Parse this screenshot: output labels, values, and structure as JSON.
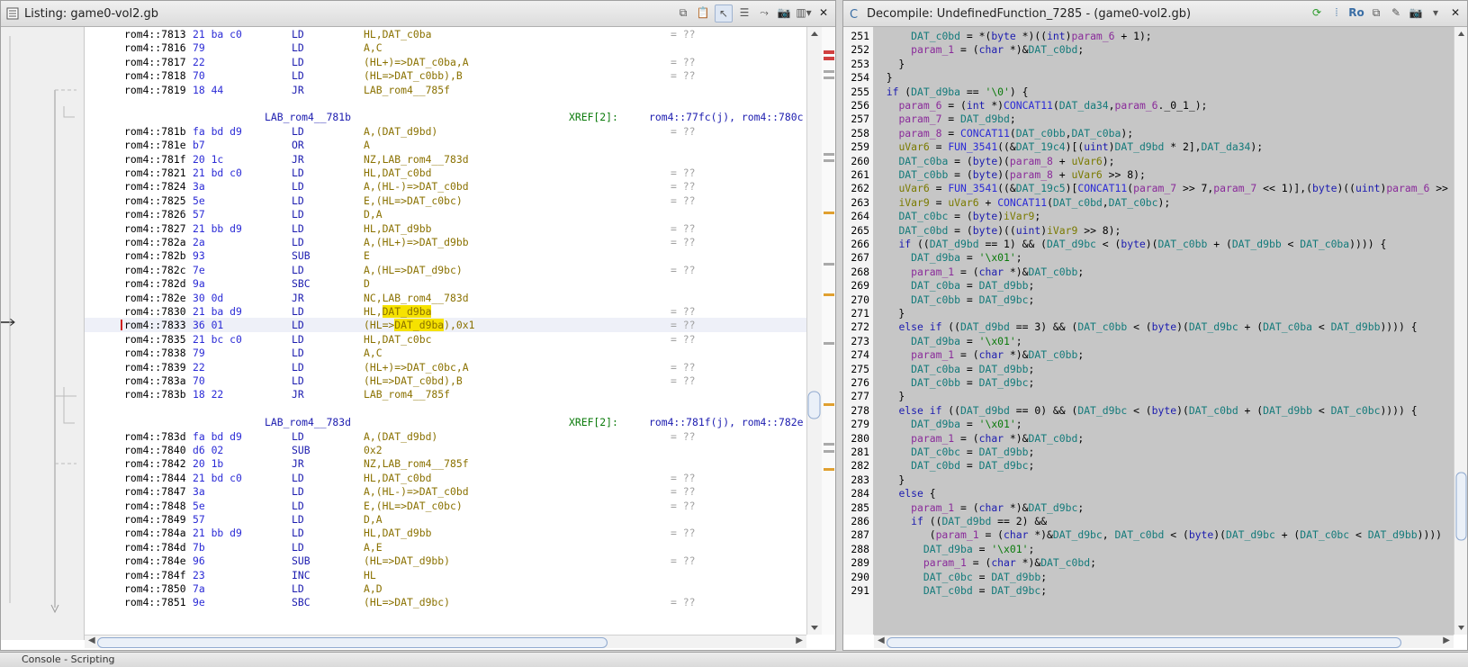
{
  "listing": {
    "title": "Listing:  game0-vol2.gb",
    "rows": [
      {
        "a": "rom4::7813",
        "b": "21 ba c0",
        "m": "LD",
        "o": "HL,DAT_c0ba",
        "c": "= ??"
      },
      {
        "a": "rom4::7816",
        "b": "79",
        "m": "LD",
        "o": "A,C",
        "c": ""
      },
      {
        "a": "rom4::7817",
        "b": "22",
        "m": "LD",
        "o": "(HL+)=>DAT_c0ba,A",
        "c": "= ??"
      },
      {
        "a": "rom4::7818",
        "b": "70",
        "m": "LD",
        "o": "(HL=>DAT_c0bb),B",
        "c": "= ??"
      },
      {
        "a": "rom4::7819",
        "b": "18 44",
        "m": "JR",
        "o": "LAB_rom4__785f",
        "c": ""
      },
      {
        "blank": true
      },
      {
        "label": "LAB_rom4__781b",
        "xref": "XREF[2]:",
        "xrefv": "rom4::77fc(j), rom4::780c"
      },
      {
        "a": "rom4::781b",
        "b": "fa bd d9",
        "m": "LD",
        "o": "A,(DAT_d9bd)",
        "c": "= ??"
      },
      {
        "a": "rom4::781e",
        "b": "b7",
        "m": "OR",
        "o": "A",
        "c": ""
      },
      {
        "a": "rom4::781f",
        "b": "20 1c",
        "m": "JR",
        "o": "NZ,LAB_rom4__783d",
        "c": ""
      },
      {
        "a": "rom4::7821",
        "b": "21 bd c0",
        "m": "LD",
        "o": "HL,DAT_c0bd",
        "c": "= ??"
      },
      {
        "a": "rom4::7824",
        "b": "3a",
        "m": "LD",
        "o": "A,(HL-)=>DAT_c0bd",
        "c": "= ??"
      },
      {
        "a": "rom4::7825",
        "b": "5e",
        "m": "LD",
        "o": "E,(HL=>DAT_c0bc)",
        "c": "= ??"
      },
      {
        "a": "rom4::7826",
        "b": "57",
        "m": "LD",
        "o": "D,A",
        "c": ""
      },
      {
        "a": "rom4::7827",
        "b": "21 bb d9",
        "m": "LD",
        "o": "HL,DAT_d9bb",
        "c": "= ??"
      },
      {
        "a": "rom4::782a",
        "b": "2a",
        "m": "LD",
        "o": "A,(HL+)=>DAT_d9bb",
        "c": "= ??"
      },
      {
        "a": "rom4::782b",
        "b": "93",
        "m": "SUB",
        "o": "E",
        "c": ""
      },
      {
        "a": "rom4::782c",
        "b": "7e",
        "m": "LD",
        "o": "A,(HL=>DAT_d9bc)",
        "c": "= ??"
      },
      {
        "a": "rom4::782d",
        "b": "9a",
        "m": "SBC",
        "o": "D",
        "c": ""
      },
      {
        "a": "rom4::782e",
        "b": "30 0d",
        "m": "JR",
        "o": "NC,LAB_rom4__783d",
        "c": ""
      },
      {
        "a": "rom4::7830",
        "b": "21 ba d9",
        "m": "LD",
        "o": "HL,DAT_d9ba",
        "c": "= ??",
        "hl": true
      },
      {
        "a": "rom4::7833",
        "b": "36 01",
        "m": "LD",
        "o": "(HL=>DAT_d9ba),0x1",
        "c": "= ??",
        "sel": true,
        "hl": true
      },
      {
        "a": "rom4::7835",
        "b": "21 bc c0",
        "m": "LD",
        "o": "HL,DAT_c0bc",
        "c": "= ??"
      },
      {
        "a": "rom4::7838",
        "b": "79",
        "m": "LD",
        "o": "A,C",
        "c": ""
      },
      {
        "a": "rom4::7839",
        "b": "22",
        "m": "LD",
        "o": "(HL+)=>DAT_c0bc,A",
        "c": "= ??"
      },
      {
        "a": "rom4::783a",
        "b": "70",
        "m": "LD",
        "o": "(HL=>DAT_c0bd),B",
        "c": "= ??"
      },
      {
        "a": "rom4::783b",
        "b": "18 22",
        "m": "JR",
        "o": "LAB_rom4__785f",
        "c": ""
      },
      {
        "blank": true
      },
      {
        "label": "LAB_rom4__783d",
        "xref": "XREF[2]:",
        "xrefv": "rom4::781f(j), rom4::782e"
      },
      {
        "a": "rom4::783d",
        "b": "fa bd d9",
        "m": "LD",
        "o": "A,(DAT_d9bd)",
        "c": "= ??"
      },
      {
        "a": "rom4::7840",
        "b": "d6 02",
        "m": "SUB",
        "o": "0x2",
        "c": ""
      },
      {
        "a": "rom4::7842",
        "b": "20 1b",
        "m": "JR",
        "o": "NZ,LAB_rom4__785f",
        "c": ""
      },
      {
        "a": "rom4::7844",
        "b": "21 bd c0",
        "m": "LD",
        "o": "HL,DAT_c0bd",
        "c": "= ??"
      },
      {
        "a": "rom4::7847",
        "b": "3a",
        "m": "LD",
        "o": "A,(HL-)=>DAT_c0bd",
        "c": "= ??"
      },
      {
        "a": "rom4::7848",
        "b": "5e",
        "m": "LD",
        "o": "E,(HL=>DAT_c0bc)",
        "c": "= ??"
      },
      {
        "a": "rom4::7849",
        "b": "57",
        "m": "LD",
        "o": "D,A",
        "c": ""
      },
      {
        "a": "rom4::784a",
        "b": "21 bb d9",
        "m": "LD",
        "o": "HL,DAT_d9bb",
        "c": "= ??"
      },
      {
        "a": "rom4::784d",
        "b": "7b",
        "m": "LD",
        "o": "A,E",
        "c": ""
      },
      {
        "a": "rom4::784e",
        "b": "96",
        "m": "SUB",
        "o": "(HL=>DAT_d9bb)",
        "c": "= ??"
      },
      {
        "a": "rom4::784f",
        "b": "23",
        "m": "INC",
        "o": "HL",
        "c": ""
      },
      {
        "a": "rom4::7850",
        "b": "7a",
        "m": "LD",
        "o": "A,D",
        "c": ""
      },
      {
        "a": "rom4::7851",
        "b": "9e",
        "m": "SBC",
        "o": "(HL=>DAT_d9bc)",
        "c": "= ??"
      }
    ]
  },
  "decompiler": {
    "title": "Decompile: UndefinedFunction_7285 -  (game0-vol2.gb)",
    "first_line": 251,
    "lines": [
      "      DAT_c0bd = *(byte *)((int)param_6 + 1);",
      "      param_1 = (char *)&DAT_c0bd;",
      "    }",
      "  }",
      "  if (DAT_d9ba == '\\0') {",
      "    param_6 = (int *)CONCAT11(DAT_da34,param_6._0_1_);",
      "    param_7 = DAT_d9bd;",
      "    param_8 = CONCAT11(DAT_c0bb,DAT_c0ba);",
      "    uVar6 = FUN_3541((&DAT_19c4)[(uint)DAT_d9bd * 2],DAT_da34);",
      "    DAT_c0ba = (byte)(param_8 + uVar6);",
      "    DAT_c0bb = (byte)(param_8 + uVar6 >> 8);",
      "    uVar6 = FUN_3541((&DAT_19c5)[CONCAT11(param_7 >> 7,param_7 << 1)],(byte)((uint)param_6 >>",
      "    iVar9 = uVar6 + CONCAT11(DAT_c0bd,DAT_c0bc);",
      "    DAT_c0bc = (byte)iVar9;",
      "    DAT_c0bd = (byte)((uint)iVar9 >> 8);",
      "    if ((DAT_d9bd == 1) && (DAT_d9bc < (byte)(DAT_c0bb + (DAT_d9bb < DAT_c0ba)))) {",
      "      DAT_d9ba = '\\x01';",
      "      param_1 = (char *)&DAT_c0bb;",
      "      DAT_c0ba = DAT_d9bb;",
      "      DAT_c0bb = DAT_d9bc;",
      "    }",
      "    else if ((DAT_d9bd == 3) && (DAT_c0bb < (byte)(DAT_d9bc + (DAT_c0ba < DAT_d9bb)))) {",
      "      DAT_d9ba = '\\x01';",
      "      param_1 = (char *)&DAT_c0bb;",
      "      DAT_c0ba = DAT_d9bb;",
      "      DAT_c0bb = DAT_d9bc;",
      "    }",
      "    else if ((DAT_d9bd == 0) && (DAT_d9bc < (byte)(DAT_c0bd + (DAT_d9bb < DAT_c0bc)))) {",
      "      DAT_d9ba = '\\x01';",
      "      param_1 = (char *)&DAT_c0bd;",
      "      DAT_c0bc = DAT_d9bb;",
      "      DAT_c0bd = DAT_d9bc;",
      "    }",
      "    else {",
      "      param_1 = (char *)&DAT_d9bc;",
      "      if ((DAT_d9bd == 2) &&",
      "         (param_1 = (char *)&DAT_d9bc, DAT_c0bd < (byte)(DAT_d9bc + (DAT_c0bc < DAT_d9bb))))",
      "        DAT_d9ba = '\\x01';",
      "        param_1 = (char *)&DAT_c0bd;",
      "        DAT_c0bc = DAT_d9bb;",
      "        DAT_c0bd = DAT_d9bc;"
    ]
  },
  "bottom": {
    "label": "Console - Scripting"
  }
}
